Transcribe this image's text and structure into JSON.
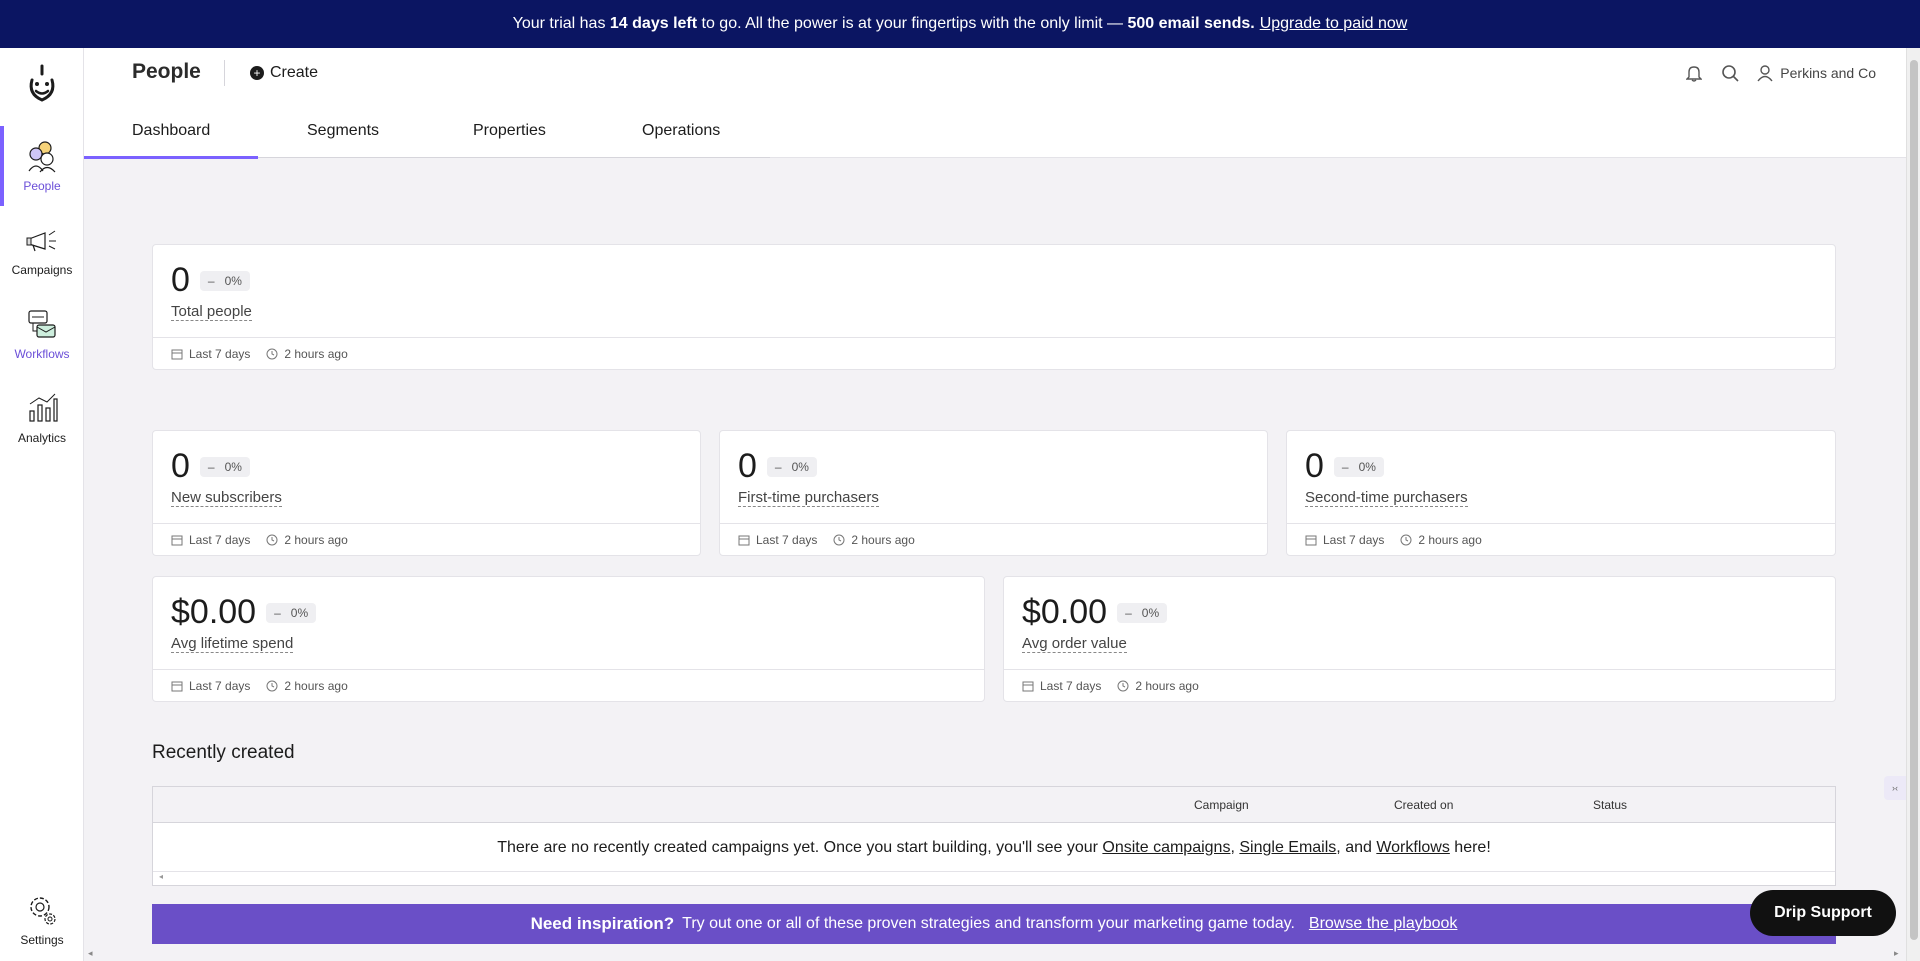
{
  "banner": {
    "pre": "Your trial has",
    "days": "14 days left",
    "mid": "to go. All the power is at your fingertips with the only limit —",
    "limit": "500 email sends.",
    "link": "Upgrade to paid now"
  },
  "sidebar": {
    "items": [
      {
        "label": "People",
        "icon": "people-icon"
      },
      {
        "label": "Campaigns",
        "icon": "megaphone-icon"
      },
      {
        "label": "Workflows",
        "icon": "workflow-icon"
      },
      {
        "label": "Analytics",
        "icon": "analytics-icon"
      },
      {
        "label": "Settings",
        "icon": "gear-icon"
      }
    ]
  },
  "header": {
    "title": "People",
    "create": "Create",
    "account": "Perkins and Co",
    "tabs": [
      "Dashboard",
      "Segments",
      "Properties",
      "Operations"
    ]
  },
  "cards": [
    {
      "value": "0",
      "delta_sign": "–",
      "delta": "0%",
      "label": "Total people",
      "range": "Last 7 days",
      "updated": "2 hours ago"
    },
    {
      "value": "0",
      "delta_sign": "–",
      "delta": "0%",
      "label": "New subscribers",
      "range": "Last 7 days",
      "updated": "2 hours ago"
    },
    {
      "value": "0",
      "delta_sign": "–",
      "delta": "0%",
      "label": "First-time purchasers",
      "range": "Last 7 days",
      "updated": "2 hours ago"
    },
    {
      "value": "0",
      "delta_sign": "–",
      "delta": "0%",
      "label": "Second-time purchasers",
      "range": "Last 7 days",
      "updated": "2 hours ago"
    },
    {
      "value": "$0.00",
      "delta_sign": "–",
      "delta": "0%",
      "label": "Avg lifetime spend",
      "range": "Last 7 days",
      "updated": "2 hours ago"
    },
    {
      "value": "$0.00",
      "delta_sign": "–",
      "delta": "0%",
      "label": "Avg order value",
      "range": "Last 7 days",
      "updated": "2 hours ago"
    }
  ],
  "recent": {
    "title": "Recently created",
    "columns": [
      "Campaign",
      "Created on",
      "Status"
    ],
    "empty_pre": "There are no recently created campaigns yet. Once you start building, you'll see your",
    "link1": "Onsite campaigns",
    "comma": ",",
    "link2": "Single Emails",
    "and": ", and",
    "link3": "Workflows",
    "empty_post": "here!"
  },
  "promo": {
    "title": "Need inspiration?",
    "text": "Try out one or all of these proven strategies and transform your marketing game today.",
    "link": "Browse the playbook"
  },
  "support": "Drip Support",
  "colors": {
    "accent": "#7b61ff",
    "banner": "#0b1562",
    "promo": "#6a4fc7"
  }
}
